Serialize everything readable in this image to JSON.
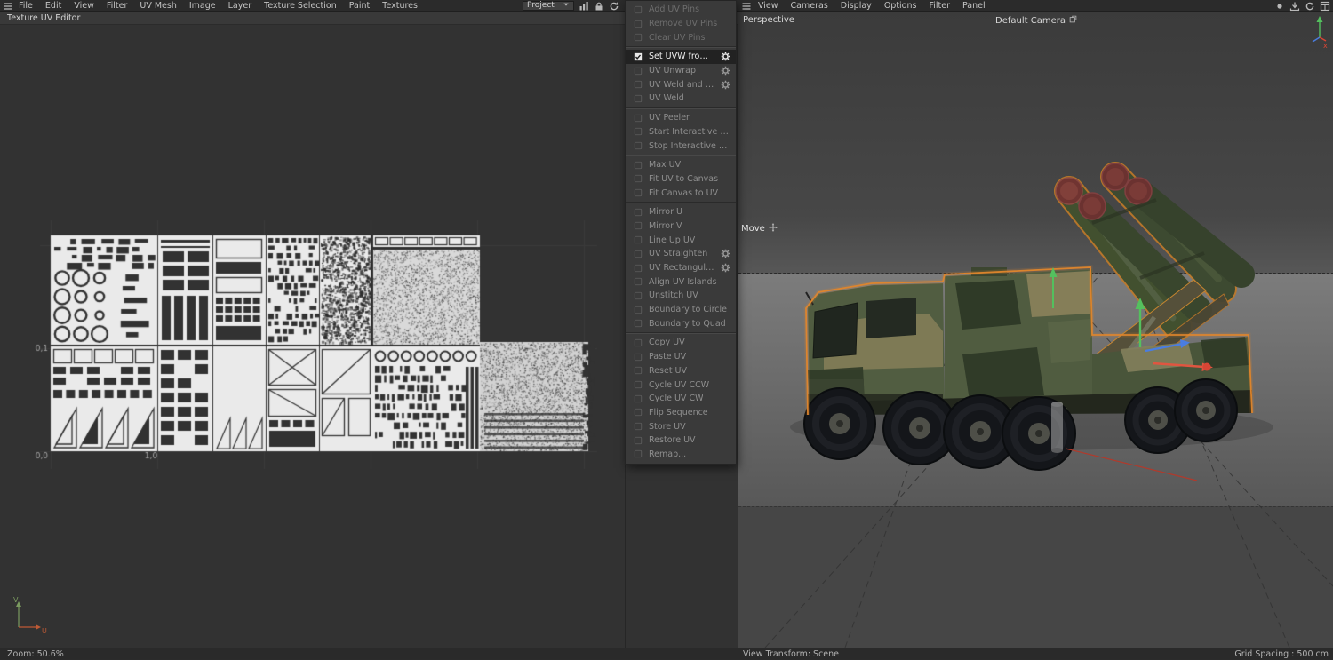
{
  "menubar": {
    "left_items": [
      "File",
      "Edit",
      "View",
      "Filter",
      "UV Mesh",
      "Image",
      "Layer",
      "Texture Selection",
      "Paint",
      "Textures"
    ],
    "project_dropdown": "Project"
  },
  "uv_editor": {
    "title": "Texture UV Editor",
    "coord_labels": {
      "top": "0,1",
      "origin": "0,0",
      "right": "1,0"
    },
    "axis": {
      "v": "V",
      "u": "U"
    },
    "status_zoom": "Zoom: 50.6%"
  },
  "context_menu": {
    "items": [
      {
        "label": "Add UV Pins",
        "dim": true
      },
      {
        "label": "Remove UV Pins",
        "dim": true
      },
      {
        "label": "Clear UV Pins",
        "dim": true
      },
      {
        "sep": true
      },
      {
        "label": "Set UVW from Projection",
        "selected": true,
        "checked": true,
        "gear": true
      },
      {
        "label": "UV Unwrap",
        "gear": true
      },
      {
        "label": "UV Weld and Relax",
        "gear": true
      },
      {
        "label": "UV Weld"
      },
      {
        "sep": true
      },
      {
        "label": "UV Peeler"
      },
      {
        "label": "Start Interactive Mapping"
      },
      {
        "label": "Stop Interactive Mapping"
      },
      {
        "sep": true
      },
      {
        "label": "Max UV"
      },
      {
        "label": "Fit UV to Canvas"
      },
      {
        "label": "Fit Canvas to UV"
      },
      {
        "sep": true
      },
      {
        "label": "Mirror U"
      },
      {
        "label": "Mirror V"
      },
      {
        "label": "Line Up UV"
      },
      {
        "label": "UV Straighten",
        "gear": true
      },
      {
        "label": "UV Rectangularize",
        "gear": true
      },
      {
        "label": "Align UV Islands"
      },
      {
        "label": "Unstitch UV"
      },
      {
        "label": "Boundary to Circle"
      },
      {
        "label": "Boundary to Quad"
      },
      {
        "sep": true
      },
      {
        "label": "Copy UV"
      },
      {
        "label": "Paste UV"
      },
      {
        "label": "Reset UV"
      },
      {
        "label": "Cycle UV CCW"
      },
      {
        "label": "Cycle UV CW"
      },
      {
        "label": "Flip Sequence"
      },
      {
        "label": "Store UV"
      },
      {
        "label": "Restore UV"
      },
      {
        "label": "Remap..."
      }
    ]
  },
  "viewport": {
    "menu_items": [
      "View",
      "Cameras",
      "Display",
      "Options",
      "Filter",
      "Panel"
    ],
    "view_label": "Perspective",
    "camera_label": "Default Camera",
    "tool_label": "Move",
    "axis_x_label": "x",
    "status_left": "View Transform: Scene",
    "status_right": "Grid Spacing : 500 cm"
  },
  "colors": {
    "selection_outline": "#e0862c",
    "axis_x": "#d84535",
    "axis_y": "#54c05e",
    "axis_z": "#4a7de0",
    "uv_island": "#eaeaea",
    "editor_background": "#323232"
  }
}
